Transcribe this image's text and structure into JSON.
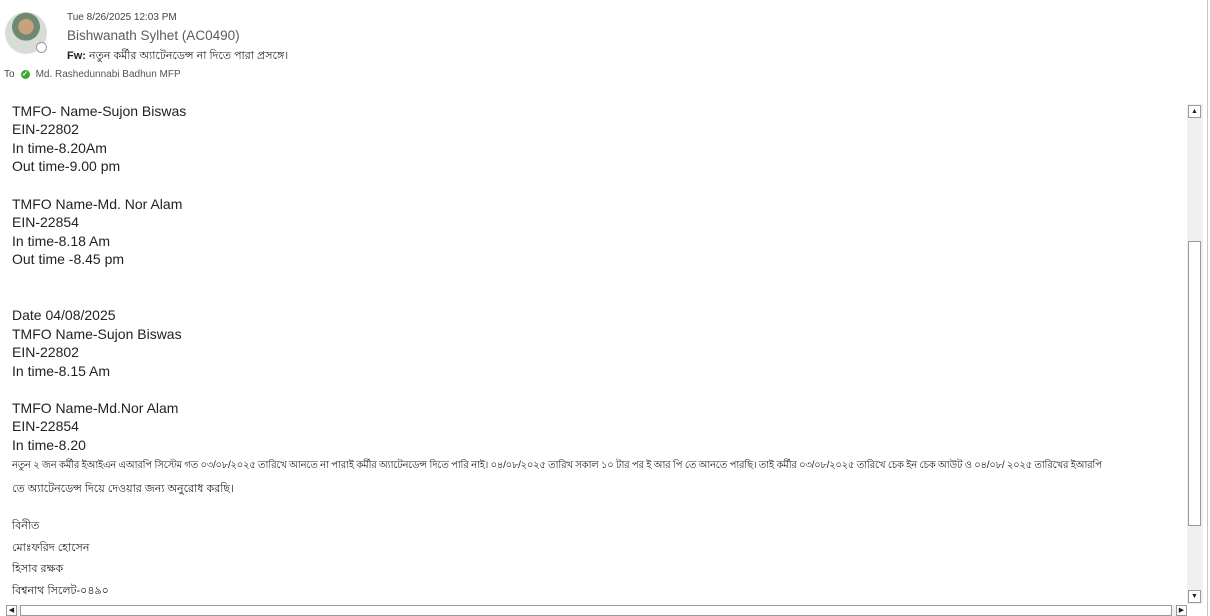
{
  "header": {
    "date": "Tue 8/26/2025 12:03 PM",
    "sender": "Bishwanath Sylhet (AC0490)",
    "subject_prefix": "Fw:",
    "subject": "নতুন কর্মীর অ্যাটেনডেন্স না দিতে পারা প্রসঙ্গে।",
    "to_label": "To",
    "recipient": "Md. Rashedunnabi Badhun MFP"
  },
  "body": {
    "lines": [
      "TMFO- Name-Sujon Biswas",
      "EIN-22802",
      "In time-8.20Am",
      "Out time-9.00 pm",
      "TMFO Name-Md. Nor Alam",
      "EIN-22854",
      "In time-8.18 Am",
      "Out time -8.45 pm",
      "Date 04/08/2025",
      "TMFO Name-Sujon Biswas",
      "EIN-22802",
      "In time-8.15 Am",
      "TMFO Name-Md.Nor Alam",
      "EIN-22854",
      "In time-8.20"
    ],
    "paragraph_1": "নতুন ২ জন কর্মীর ইআইএন এআরপি সিস্টেম গত ০৩/০৮/২০২৫ তারিখে আনতে না পারাই কর্মীর অ্যাটেনডেন্স দিতে পারি নাই। ০৪/০৮/২০২৫ তারিখ সকাল ১০ টার পর ই আর পি তে  আনতে পারছি। তাই কর্মীর ০৩/০৮/২০২৫ তারিখে চেক ইন চেক আউট ও ০৪/০৮/ ২০২৫ তারিখের ইআরপি",
    "paragraph_2": "তে অ্যাটেনডেন্স দিয়ে দেওয়ার  জন্য অনুরোধ করছি।",
    "closing": "বিনীত",
    "sig_name": "মোঃফরিদ হোসেন",
    "sig_title": "হিসাব রক্ষক",
    "sig_branch": "বিশ্বনাথ সিলেট-০৪৯০"
  },
  "icons": {
    "scroll_up": "up-arrow-icon",
    "scroll_down": "down-arrow-icon",
    "scroll_left": "left-arrow-icon",
    "scroll_right": "right-arrow-icon",
    "presence": "presence-status-icon",
    "verified": "check-circle-icon"
  },
  "colors": {
    "verified_green": "#3fa535",
    "sender_text": "#5c5c5c"
  }
}
